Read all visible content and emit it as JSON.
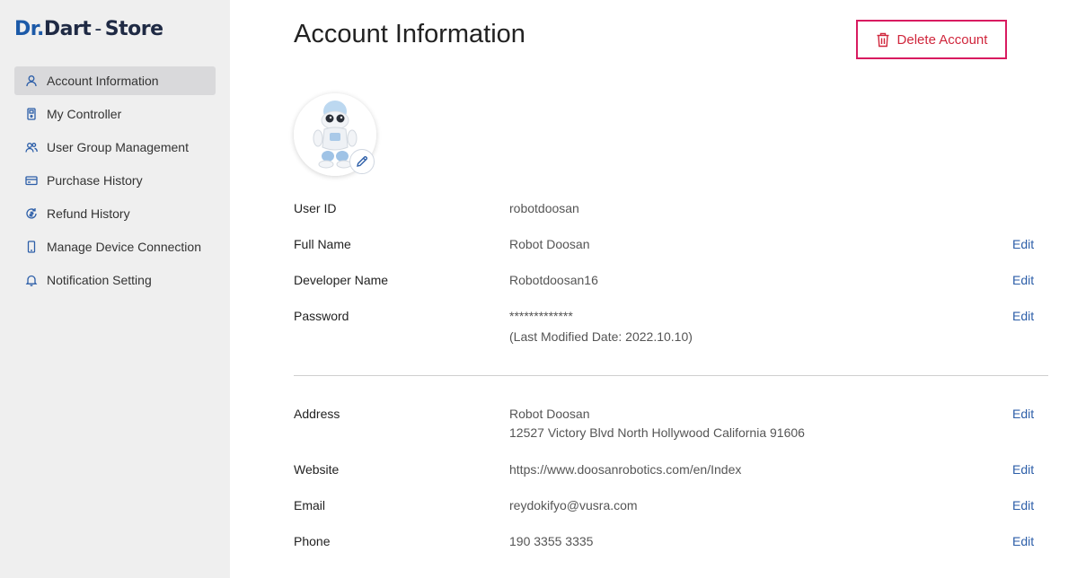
{
  "brand": {
    "dr": "Dr",
    "dot": ".",
    "dart": "Dart",
    "sep": "-",
    "store": "Store"
  },
  "sidebar": {
    "items": [
      {
        "label": "Account Information",
        "icon": "user-icon"
      },
      {
        "label": "My Controller",
        "icon": "controller-icon"
      },
      {
        "label": "User Group Management",
        "icon": "group-icon"
      },
      {
        "label": "Purchase History",
        "icon": "card-icon"
      },
      {
        "label": "Refund History",
        "icon": "refund-icon"
      },
      {
        "label": "Manage Device Connection",
        "icon": "device-icon"
      },
      {
        "label": "Notification Setting",
        "icon": "bell-icon"
      }
    ],
    "active_index": 0
  },
  "main": {
    "title": "Account Information",
    "delete_label": "Delete Account",
    "edit_label": "Edit",
    "fields": {
      "user_id": {
        "label": "User ID",
        "value": "robotdoosan"
      },
      "full_name": {
        "label": "Full Name",
        "value": "Robot Doosan"
      },
      "developer_name": {
        "label": "Developer Name",
        "value": "Robotdoosan16"
      },
      "password": {
        "label": "Password",
        "value": "*************",
        "note": "(Last Modified Date: 2022.10.10)"
      },
      "address": {
        "label": "Address",
        "line1": "Robot Doosan",
        "line2": "12527 Victory Blvd North Hollywood California 91606"
      },
      "website": {
        "label": "Website",
        "value": "https://www.doosanrobotics.com/en/Index"
      },
      "email": {
        "label": "Email",
        "value": "reydokifyo@vusra.com"
      },
      "phone": {
        "label": "Phone",
        "value": "190 3355 3335"
      }
    }
  },
  "colors": {
    "accent": "#2c5ea8",
    "danger": "#d81b60",
    "sidebar_bg": "#efefef",
    "active_bg": "#d9d9db"
  }
}
